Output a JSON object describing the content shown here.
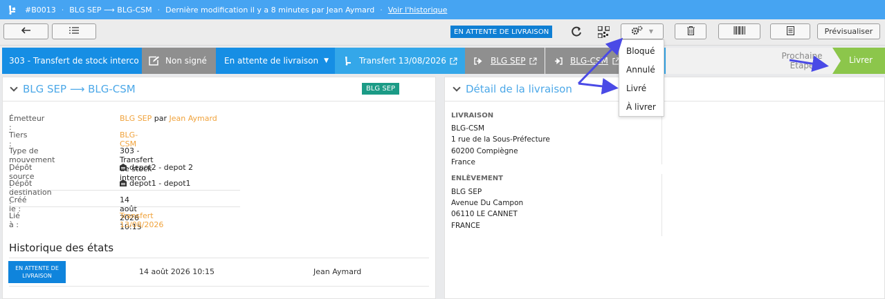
{
  "topbar": {
    "icon": "truck-icon",
    "ref": "#B0013",
    "route": "BLG SEP ⟶ BLG-CSM",
    "modified": "Dernière modification il y a 8 minutes par Jean Aymard",
    "history_link": "Voir l'historique"
  },
  "toolbar": {
    "status": "EN ATTENTE DE LIVRAISON",
    "preview_label": "Prévisualiser"
  },
  "ribbon": {
    "type": "303 - Transfert de stock interco",
    "signature": "Non signé",
    "state": "En attente de livraison",
    "transfer": "Transfert 13/08/2026",
    "from": "BLG SEP",
    "to": "BLG-CSM",
    "next_label": "Prochaine Étape",
    "next_action": "Livrer",
    "colors": {
      "blue": "#168ee4",
      "gray": "#8f8f8f",
      "teal": "#34a7e9",
      "green": "#8cc64b"
    }
  },
  "dropdown": {
    "items": [
      "Bloqué",
      "Annulé",
      "Livré",
      "À livrer"
    ]
  },
  "left_panel": {
    "title": "BLG SEP ⟶ BLG-CSM",
    "badge": "BLG SEP",
    "fields": {
      "emetteur_label": "Émetteur :",
      "emetteur_org": "BLG SEP",
      "emetteur_by": "par",
      "emetteur_person": "Jean Aymard",
      "tiers_label": "Tiers :",
      "tiers_value": "BLG-CSM",
      "type_label": "Type de mouvement :",
      "type_value": "303 - Transfert de stock interco",
      "source_label": "Dépôt source :",
      "source_value": "depot2 - depot 2",
      "dest_label": "Dépôt destination :",
      "dest_value": "depot1 - depot1",
      "created_label": "Créé le :",
      "created_value": "14 août 2026 10:15",
      "linked_label": "Lié à :",
      "linked_value": "Transfert 13/08/2026"
    },
    "history": {
      "title": "Historique des états",
      "rows": [
        {
          "state": "EN ATTENTE DE LIVRAISON",
          "date": "14 août 2026 10:15",
          "user": "Jean Aymard"
        }
      ]
    }
  },
  "right_panel": {
    "title": "Détail de la livraison",
    "delivery": {
      "heading": "LIVRAISON",
      "name": "BLG-CSM",
      "line1": "1 rue de la Sous-Préfecture",
      "line2": "60200 Compiègne",
      "line3": "France"
    },
    "pickup": {
      "heading": "ENLÈVEMENT",
      "name": "BLG SEP",
      "line1": "Avenue Du Campon",
      "line2": "06110 LE CANNET",
      "line3": "FRANCE"
    }
  }
}
